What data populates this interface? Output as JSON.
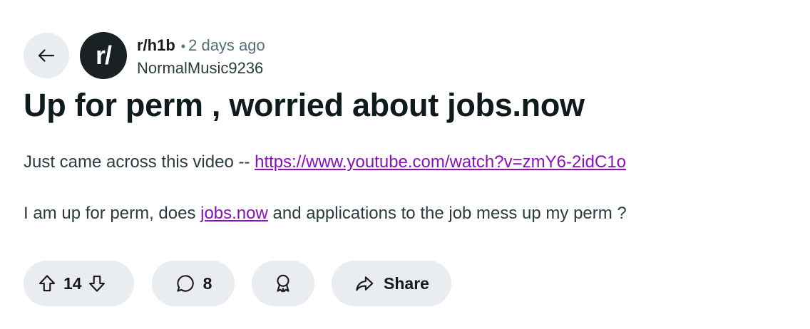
{
  "post": {
    "subreddit": "r/h1b",
    "avatar_text": "r/",
    "separator": "•",
    "time_ago": "2 days ago",
    "author": "NormalMusic9236",
    "title": "Up for perm , worried about jobs.now",
    "body": {
      "p1_text": "Just came across this video -- ",
      "p1_link": "https://www.youtube.com/watch?v=zmY6-2idC1o",
      "p2_pre": "I am up for perm, does ",
      "p2_link": "jobs.now",
      "p2_post": " and applications to the job mess up my perm ?"
    }
  },
  "actions": {
    "vote_count": "14",
    "comment_count": "8",
    "share_label": "Share"
  },
  "icons": {
    "back": "arrow-left-icon",
    "upvote": "arrow-up-icon",
    "downvote": "arrow-down-icon",
    "comment": "speech-bubble-icon",
    "award": "award-ribbon-icon",
    "share": "share-arrow-icon"
  },
  "colors": {
    "pill_bg": "#eaedef",
    "link": "#8a0fbd",
    "avatar_bg": "#1a2124",
    "muted": "#576f76"
  }
}
